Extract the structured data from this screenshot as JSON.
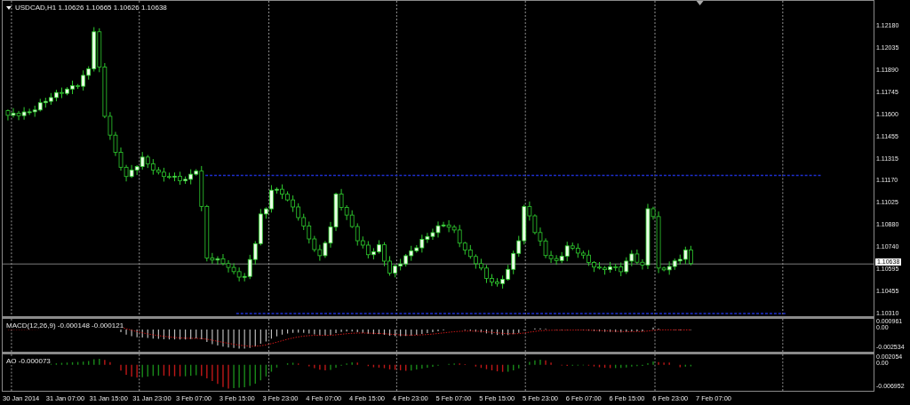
{
  "chart": {
    "symbol": "USDCAD,H1",
    "ohlc": [
      "1.10626",
      "1.10665",
      "1.10626",
      "1.10638"
    ],
    "price_ticks": [
      "1.12180",
      "1.12035",
      "1.11890",
      "1.11745",
      "1.11600",
      "1.11455",
      "1.11315",
      "1.11170",
      "1.11025",
      "1.10880",
      "1.10740",
      "1.10595",
      "1.10455",
      "1.10310"
    ],
    "current_price": "1.10638"
  },
  "macd": {
    "label": "MACD(12,26,9) -0.000148 -0.000121",
    "ticks": [
      "0.000961",
      "0.00",
      "-0.002534"
    ]
  },
  "ao": {
    "label": "AO -0.000073",
    "ticks": [
      "0.002054",
      "0.00",
      "-0.006952"
    ]
  },
  "time_axis": [
    "30 Jan 2014",
    "31 Jan 07:00",
    "31 Jan 15:00",
    "31 Jan 23:00",
    "3 Feb 07:00",
    "3 Feb 15:00",
    "3 Feb 23:00",
    "4 Feb 07:00",
    "4 Feb 15:00",
    "4 Feb 23:00",
    "5 Feb 07:00",
    "5 Feb 15:00",
    "5 Feb 23:00",
    "6 Feb 07:00",
    "6 Feb 15:00",
    "6 Feb 23:00",
    "7 Feb 07:00"
  ]
}
